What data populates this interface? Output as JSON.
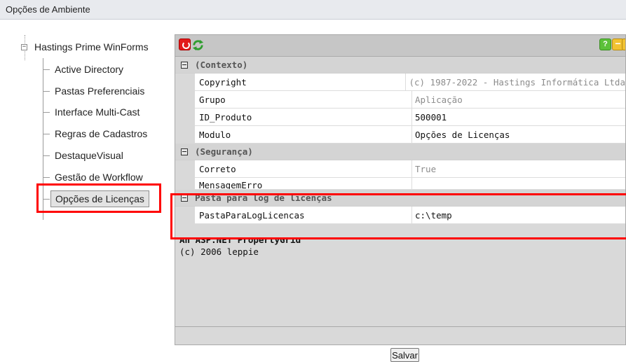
{
  "window": {
    "title": "Opções de Ambiente"
  },
  "tree": {
    "root_label": "Hastings Prime WinForms",
    "items": [
      {
        "label": "Active Directory"
      },
      {
        "label": "Pastas Preferenciais"
      },
      {
        "label": "Interface Multi-Cast"
      },
      {
        "label": "Regras de Cadastros"
      },
      {
        "label": "DestaqueVisual"
      },
      {
        "label": "Gestão de Workflow"
      },
      {
        "label": "Opções de Licenças"
      }
    ],
    "selected": "Opções de Licenças"
  },
  "toolbar": {
    "power_icon": "power-icon",
    "refresh_icon": "refresh-icon",
    "help_label": "?",
    "minus_label": "−"
  },
  "grid": {
    "categories": [
      {
        "name": "(Contexto)",
        "rows": [
          {
            "name": "Copyright",
            "value": "(c) 1987-2022 - Hastings Informática Ltda"
          },
          {
            "name": "Grupo",
            "value": "Aplicação"
          },
          {
            "name": "ID_Produto",
            "value": "500001"
          },
          {
            "name": "Modulo",
            "value": "Opções de Licenças"
          }
        ]
      },
      {
        "name": "(Segurança)",
        "rows": [
          {
            "name": "Correto",
            "value": "True"
          },
          {
            "name": "MensagemErro",
            "value": ""
          }
        ]
      },
      {
        "name": "Pasta para log de licenças",
        "rows": [
          {
            "name": "PastaParaLogLicencas",
            "value": "c:\\temp"
          }
        ]
      }
    ],
    "description": {
      "title": "An ASP.NET PropertyGrid",
      "text": "(c) 2006 leppie"
    }
  },
  "actions": {
    "save_label": "Salvar"
  },
  "colors": {
    "highlight": "#ff0000",
    "readonly_text": "#8c8c8c",
    "grid_bg": "#d9d9d9"
  }
}
